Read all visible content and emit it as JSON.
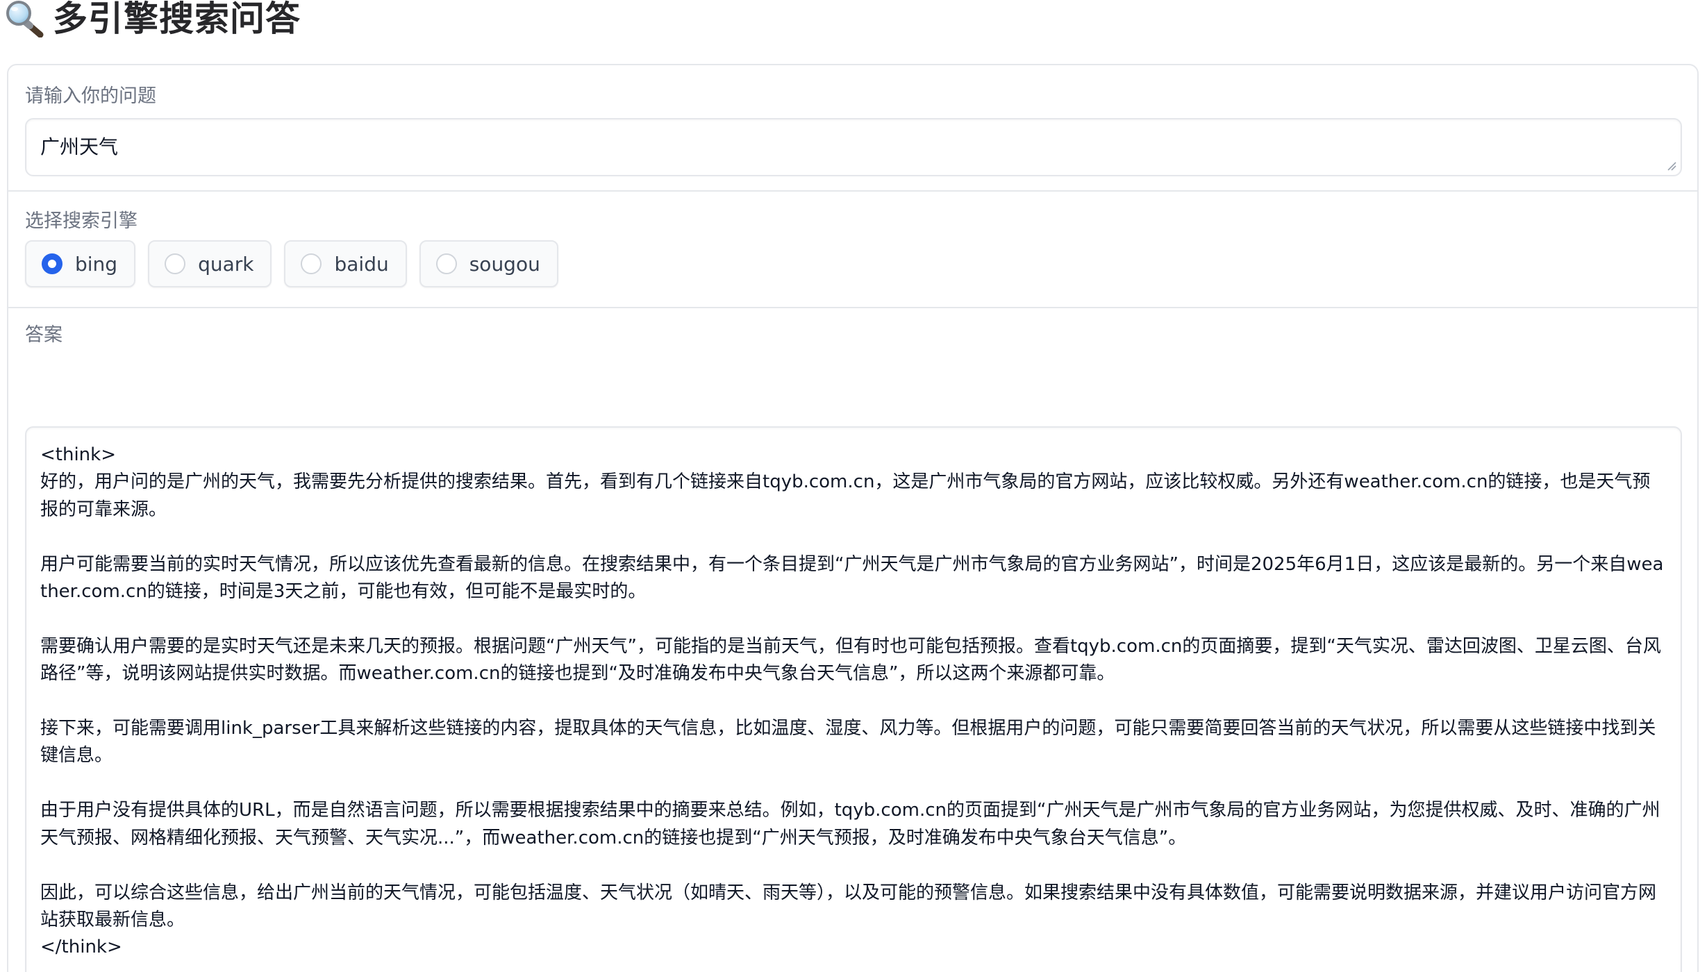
{
  "header": {
    "title": "多引擎搜索问答",
    "icon": "magnifier-icon"
  },
  "question": {
    "label": "请输入你的问题",
    "value": "广州天气"
  },
  "engine": {
    "label": "选择搜索引擎",
    "selected": "bing",
    "options": [
      "bing",
      "quark",
      "baidu",
      "sougou"
    ]
  },
  "answer": {
    "label": "答案",
    "text": "<think>\n好的，用户问的是广州的天气，我需要先分析提供的搜索结果。首先，看到有几个链接来自tqyb.com.cn，这是广州市气象局的官方网站，应该比较权威。另外还有weather.com.cn的链接，也是天气预报的可靠来源。\n\n用户可能需要当前的实时天气情况，所以应该优先查看最新的信息。在搜索结果中，有一个条目提到“广州天气是广州市气象局的官方业务网站”，时间是2025年6月1日，这应该是最新的。另一个来自weather.com.cn的链接，时间是3天之前，可能也有效，但可能不是最实时的。\n\n需要确认用户需要的是实时天气还是未来几天的预报。根据问题“广州天气”，可能指的是当前天气，但有时也可能包括预报。查看tqyb.com.cn的页面摘要，提到“天气实况、雷达回波图、卫星云图、台风路径”等，说明该网站提供实时数据。而weather.com.cn的链接也提到“及时准确发布中央气象台天气信息”，所以这两个来源都可靠。\n\n接下来，可能需要调用link_parser工具来解析这些链接的内容，提取具体的天气信息，比如温度、湿度、风力等。但根据用户的问题，可能只需要简要回答当前的天气状况，所以需要从这些链接中找到关键信息。\n\n由于用户没有提供具体的URL，而是自然语言问题，所以需要根据搜索结果中的摘要来总结。例如，tqyb.com.cn的页面提到“广州天气是广州市气象局的官方业务网站，为您提供权威、及时、准确的广州天气预报、网格精细化预报、天气预警、天气实况...”，而weather.com.cn的链接也提到“广州天气预报，及时准确发布中央气象台天气信息”。\n\n因此，可以综合这些信息，给出广州当前的天气情况，可能包括温度、天气状况（如晴天、雨天等），以及可能的预警信息。如果搜索结果中没有具体数值，可能需要说明数据来源，并建议用户访问官方网站获取最新信息。\n</think>\n\n### 广州当前天气情况"
  },
  "colors": {
    "accent": "#2563eb",
    "border": "#e5e7eb",
    "label": "#6b7280"
  }
}
